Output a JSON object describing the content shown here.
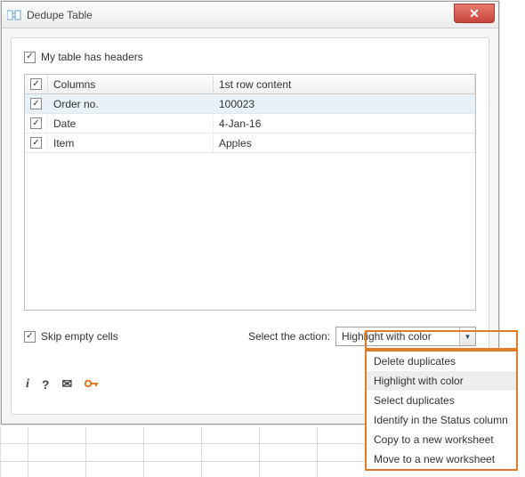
{
  "window": {
    "title": "Dedupe Table",
    "close_label": "✕"
  },
  "options": {
    "headers_label": "My table has headers",
    "headers_checked": true,
    "skip_empty_label": "Skip empty cells",
    "skip_empty_checked": true,
    "action_label": "Select the action:"
  },
  "grid": {
    "header": {
      "chk_label": "",
      "col_columns": "Columns",
      "col_first": "1st row content"
    },
    "rows": [
      {
        "checked": true,
        "selected": true,
        "name": "Order no.",
        "first": "100023"
      },
      {
        "checked": true,
        "selected": false,
        "name": "Date",
        "first": "4-Jan-16"
      },
      {
        "checked": true,
        "selected": false,
        "name": "Item",
        "first": "Apples"
      }
    ]
  },
  "combo": {
    "selected": "Highlight with color",
    "options": [
      "Delete duplicates",
      "Highlight with color",
      "Select duplicates",
      "Identify in the Status column",
      "Copy to a new worksheet",
      "Move to a new worksheet"
    ]
  },
  "footer": {
    "info": "i",
    "help": "?",
    "mail": "✉",
    "key": "🔑"
  }
}
